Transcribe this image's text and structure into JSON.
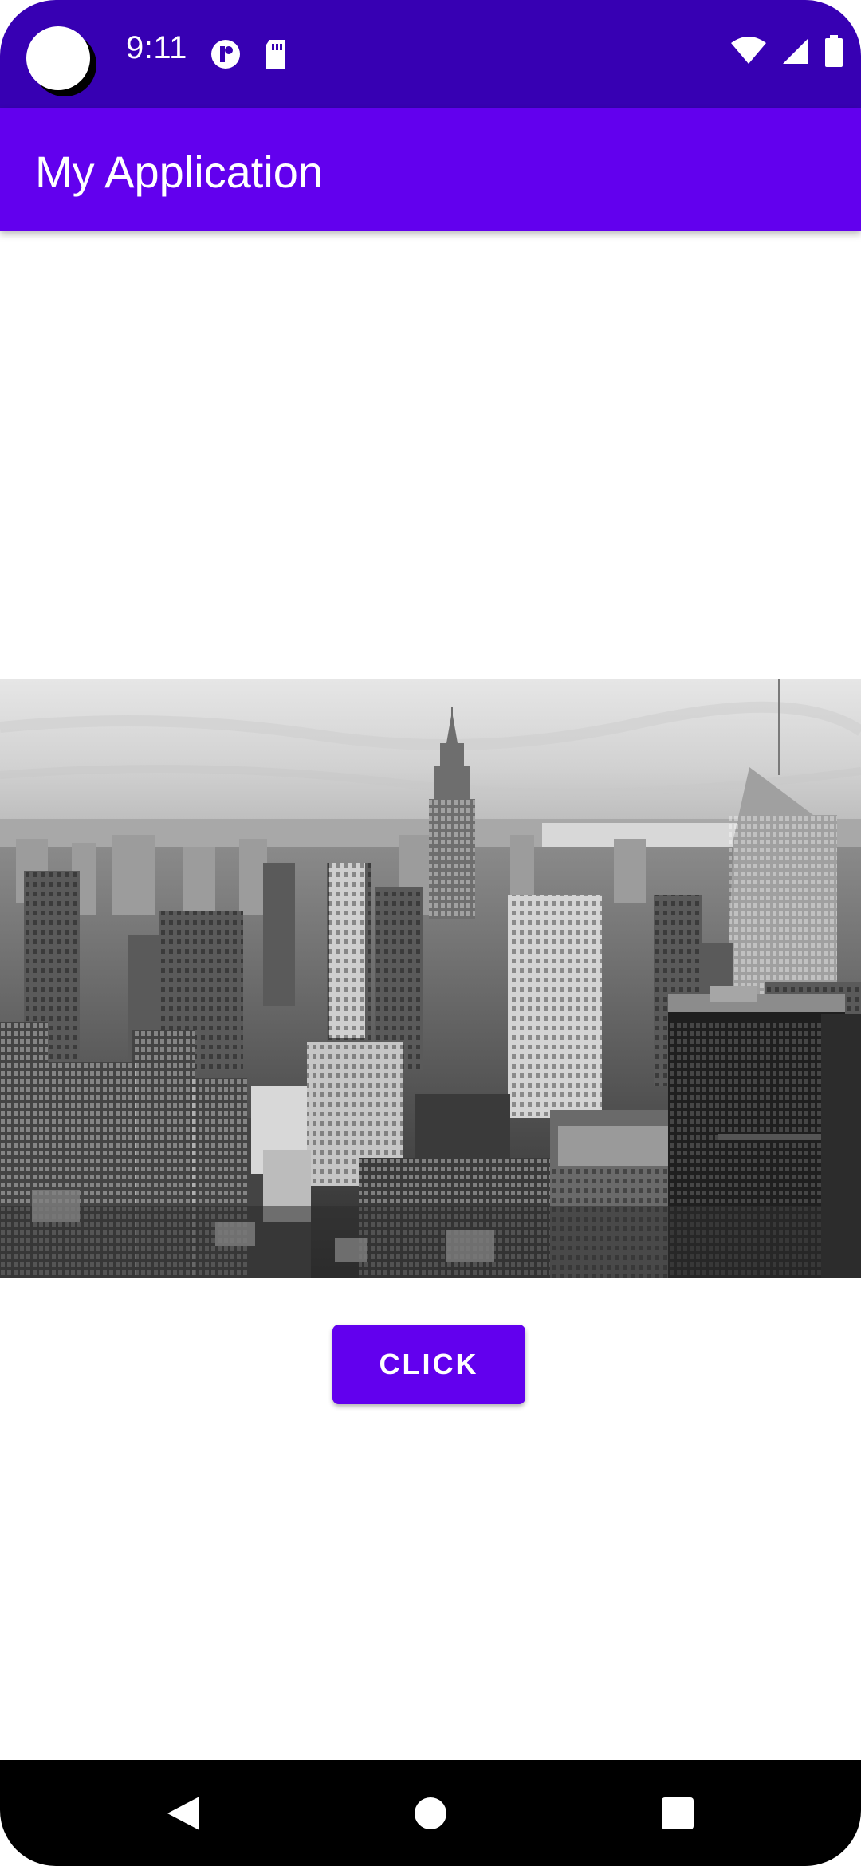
{
  "status_bar": {
    "time": "9:11",
    "icons": [
      "camera-cutout-icon",
      "record-icon",
      "sd-card-icon",
      "wifi-icon",
      "signal-icon",
      "battery-icon"
    ]
  },
  "app_bar": {
    "title": "My Application"
  },
  "main": {
    "image": {
      "alt": "city-skyline-photo"
    },
    "button": {
      "label": "CLICK"
    }
  },
  "nav_bar": {
    "icons": [
      "back-icon",
      "home-icon",
      "recents-icon"
    ]
  },
  "colors": {
    "status_bar": "#3700b3",
    "primary": "#6200ee",
    "nav_bar": "#000000"
  }
}
